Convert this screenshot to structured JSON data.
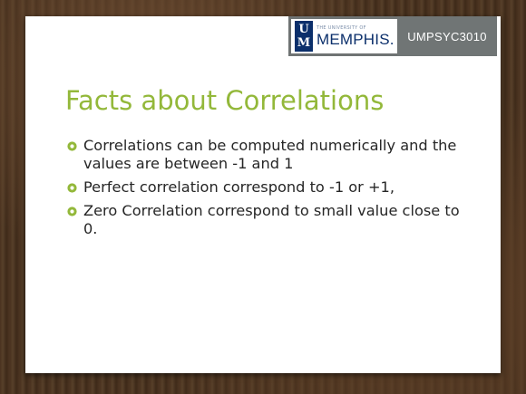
{
  "header": {
    "logo_small_text": "THE UNIVERSITY OF",
    "logo_main_text": "MEMPHIS.",
    "logo_mark_letters": [
      "U",
      "M"
    ],
    "course_code": "UMPSYC3010"
  },
  "slide": {
    "title": "Facts about Correlations",
    "bullets": [
      {
        "text": "Correlations can be computed numerically and the values are between -1 and 1"
      },
      {
        "text": "Perfect correlation correspond to -1 or +1,"
      },
      {
        "text": "Zero Correlation correspond to small value close to 0."
      }
    ]
  },
  "colors": {
    "title": "#93b83a",
    "bullet": "#93b83a",
    "body_text": "#262626",
    "course_badge": "#707575",
    "logo_navy": "#0b2f6b"
  },
  "icons": {
    "bullet": "ring-bullet-icon"
  }
}
